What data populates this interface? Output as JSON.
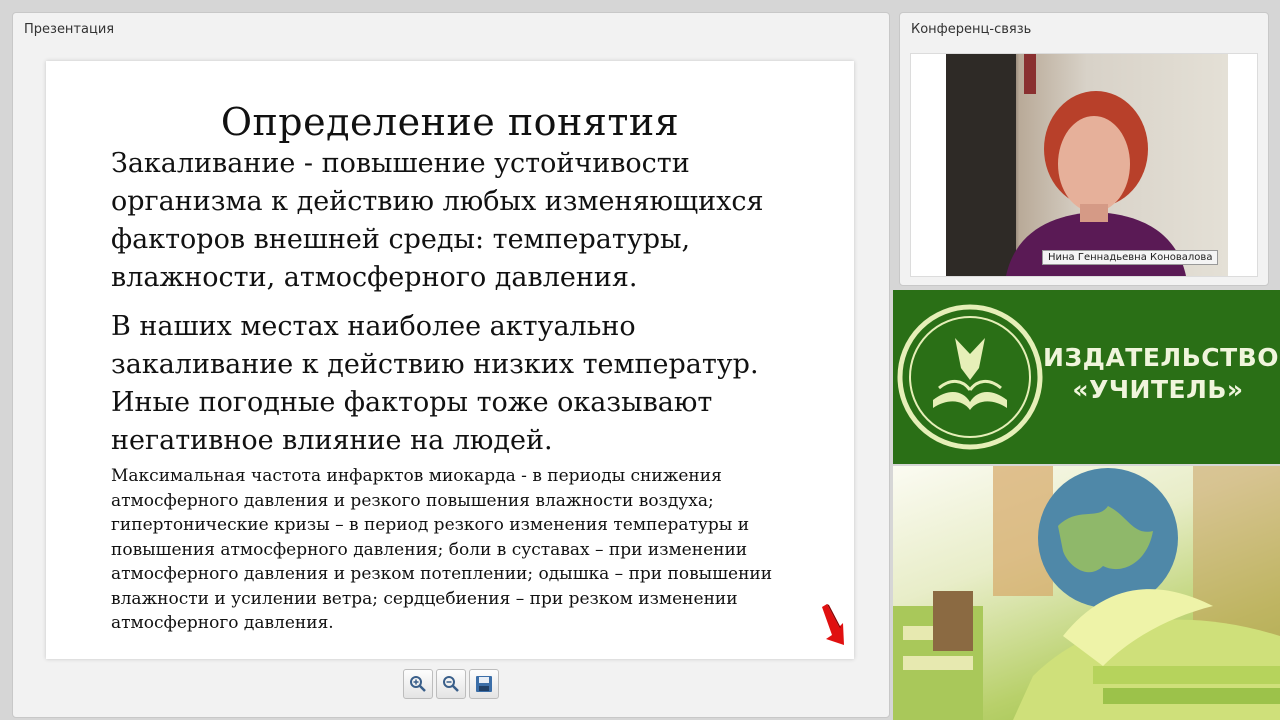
{
  "presentation_panel": {
    "title": "Презентация"
  },
  "slide": {
    "title": "Определение понятия",
    "paragraph1": [
      "Закаливание - повышение устойчивости",
      "организма к действию любых изменяющихся",
      "факторов внешней среды: температуры,",
      "влажности, атмосферного давления."
    ],
    "paragraph2": [
      "В наших местах наиболее актуально",
      "закаливание к действию низких температур.",
      "Иные погодные факторы тоже оказывают",
      "негативное влияние на людей."
    ],
    "paragraph3": [
      "Максимальная частота инфарктов миокарда - в периоды снижения",
      "атмосферного давления и резкого повышения влажности воздуха;",
      "гипертонические кризы – в период резкого изменения температуры и",
      "повышения атмосферного давления; боли в суставах – при изменении",
      "атмосферного давления и резком потеплении; одышка – при повышении",
      "влажности и усилении ветра; сердцебиения – при резком изменении",
      "атмосферного давления."
    ]
  },
  "toolbar": {
    "icons": [
      "zoom-in-icon",
      "zoom-out-icon",
      "save-icon"
    ]
  },
  "conference_panel": {
    "title": "Конференц-связь",
    "presenter_name": "Нина Геннадьевна Коновалова"
  },
  "brand": {
    "line1": "ИЗДАТЕЛЬСТВО",
    "line2": "«УЧИТЕЛЬ»"
  },
  "colors": {
    "brand_green": "#2a6f16",
    "brand_text": "#f0f5dc",
    "arrow_red": "#e01010"
  }
}
